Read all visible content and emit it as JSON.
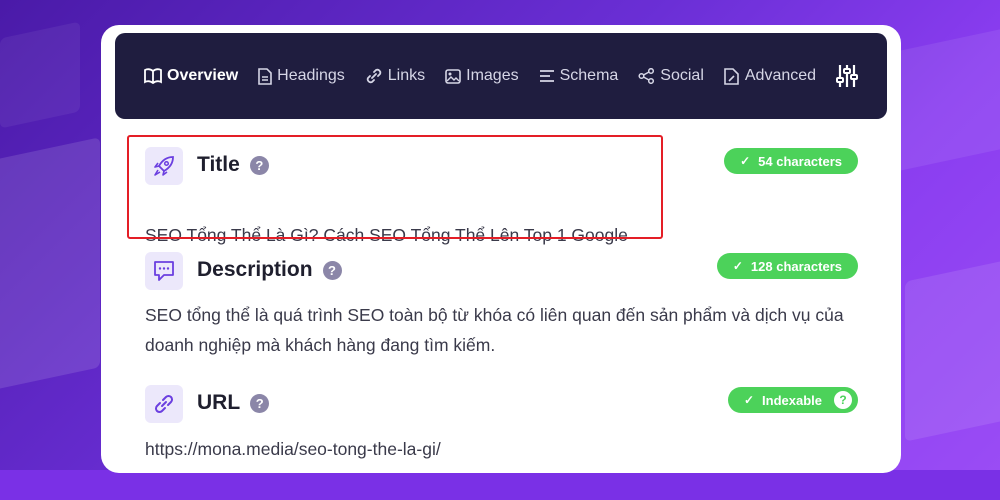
{
  "nav": {
    "tabs": [
      {
        "label": "Overview",
        "icon": "book-icon"
      },
      {
        "label": "Headings",
        "icon": "document-icon"
      },
      {
        "label": "Links",
        "icon": "link-icon"
      },
      {
        "label": "Images",
        "icon": "image-icon"
      },
      {
        "label": "Schema",
        "icon": "list-icon"
      },
      {
        "label": "Social",
        "icon": "share-icon"
      },
      {
        "label": "Advanced",
        "icon": "advanced-icon"
      }
    ],
    "active_tab": "Overview",
    "settings_icon": "sliders-icon"
  },
  "sections": {
    "title": {
      "heading": "Title",
      "help": "?",
      "badge": "54 characters",
      "text": "SEO Tổng Thể Là Gì? Cách SEO Tổng Thể Lên Top 1 Google"
    },
    "description": {
      "heading": "Description",
      "help": "?",
      "badge": "128 characters",
      "text": "SEO tổng thể là quá trình SEO toàn bộ từ khóa có liên quan đến sản phẩm và dịch vụ của doanh nghiệp mà khách hàng đang tìm kiếm."
    },
    "url": {
      "heading": "URL",
      "help": "?",
      "badge": "Indexable",
      "badge_help": "?",
      "text": "https://mona.media/seo-tong-the-la-gi/"
    }
  },
  "colors": {
    "navbar": "#1f1d3f",
    "badge_green": "#4cd25a",
    "highlight_red": "#e41e26",
    "icon_purple": "#6b3fe0",
    "background": "#6b2fd6"
  }
}
